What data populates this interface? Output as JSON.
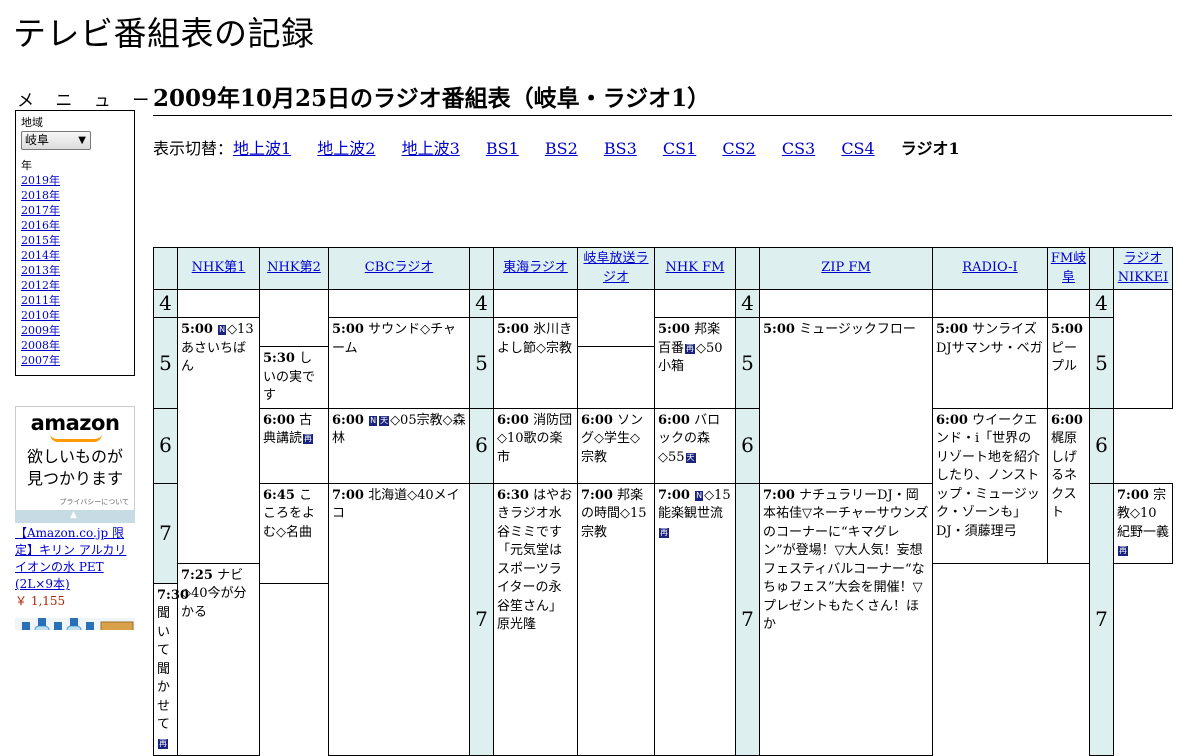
{
  "site": {
    "title": "テレビ番組表の記録"
  },
  "menu": {
    "heading": "メ ニ ュ ー",
    "region_label": "地域",
    "region_value": "岐阜",
    "year_label": "年",
    "years": [
      "2019年",
      "2018年",
      "2017年",
      "2016年",
      "2015年",
      "2014年",
      "2013年",
      "2012年",
      "2011年",
      "2010年",
      "2009年",
      "2008年",
      "2007年"
    ]
  },
  "ad": {
    "logo": "amazon",
    "tagline_1": "欲しいものが",
    "tagline_2": "見つかります",
    "privacy": "プライバシーについて",
    "product": "【Amazon.co.jp 限定】キリン アルカリイオンの水 PET (2L×9本)",
    "price": "￥ 1,155"
  },
  "main": {
    "heading": "2009年10月25日のラジオ番組表（岐阜・ラジオ1）",
    "switch_label": "表示切替：",
    "switch_links": [
      "地上波1",
      "地上波2",
      "地上波3",
      "BS1",
      "BS2",
      "BS3",
      "CS1",
      "CS2",
      "CS3",
      "CS4"
    ],
    "switch_current": "ラジオ1"
  },
  "guide": {
    "stations": [
      "NHK第1",
      "NHK第2",
      "CBCラジオ",
      "東海ラジオ",
      "岐阜放送ラジオ",
      "NHK FM",
      "ZIP FM",
      "RADIO-I",
      "FM岐阜",
      "ラジオNIKKEI"
    ],
    "hours": [
      "4",
      "5",
      "6",
      "7"
    ],
    "icons": {
      "n": "N",
      "ten": "天",
      "saih": "再"
    },
    "programs": {
      "nhk1_0500": {
        "time": "5:00",
        "pre": "",
        "post": "◇13あさいちばん"
      },
      "nhk2_0600": {
        "time": "6:00",
        "pre": "古典講読",
        "post": ""
      },
      "nhk2_0645": {
        "time": "6:45",
        "pre": "こころをよむ◇名曲",
        "post": ""
      },
      "nhk2_0730": {
        "time": "7:30",
        "pre": "聞いて聞かせて",
        "post": ""
      },
      "cbc_0500": {
        "time": "5:00",
        "pre": "サウンド◇チャーム",
        "post": ""
      },
      "cbc_0600": {
        "time": "6:00",
        "pre": "",
        "post": "◇05宗教◇森林"
      },
      "cbc_0700": {
        "time": "7:00",
        "pre": "北海道◇40メイコ",
        "post": ""
      },
      "tokai_0500": {
        "time": "5:00",
        "pre": "氷川きよし節◇宗教",
        "post": ""
      },
      "tokai_0600": {
        "time": "6:00",
        "pre": "消防団◇10歌の楽市",
        "post": ""
      },
      "tokai_0630": {
        "time": "6:30",
        "pre": "はやおきラジオ水谷ミミです「元気堂はスポーツライターの永谷笙さん」原光隆",
        "post": ""
      },
      "gifu_0530": {
        "time": "5:30",
        "pre": "しいの実です",
        "post": ""
      },
      "gifu_0600": {
        "time": "6:00",
        "pre": "ソング◇学生◇宗教",
        "post": ""
      },
      "gifu_0700": {
        "time": "7:00",
        "pre": "邦楽の時間◇15宗教",
        "post": ""
      },
      "nhkfm_0500": {
        "time": "5:00",
        "pre": "邦楽百番",
        "post": "◇50小箱"
      },
      "nhkfm_0600": {
        "time": "6:00",
        "pre": "バロックの森◇55",
        "post": ""
      },
      "nhkfm_0700": {
        "time": "7:00",
        "pre": "",
        "post": "◇15能楽観世流"
      },
      "zip_0500": {
        "time": "5:00",
        "pre": "ミュージックフロー",
        "post": ""
      },
      "zip_0700": {
        "time": "7:00",
        "pre": "ナチュラリーDJ・岡本祐佳▽ネーチャーサウンズのコーナーに“キマグレン”が登場！▽大人気！妄想フェスティバルコーナー“なちゅフェス”大会を開催！▽プレゼントもたくさん！ほか",
        "post": ""
      },
      "radioi_0500": {
        "time": "5:00",
        "pre": "サンライズDJサマンサ・ベガ",
        "post": ""
      },
      "radioi_0600": {
        "time": "6:00",
        "pre": "ウイークエンド・i「世界のリゾート地を紹介したり、ノンストップ・ミュージック・ゾーンも」DJ・須藤理弓",
        "post": ""
      },
      "fmgifu_0500": {
        "time": "5:00",
        "pre": "ピープル",
        "post": ""
      },
      "fmgifu_0600": {
        "time": "6:00",
        "pre": "梶原しげるネクスト",
        "post": ""
      },
      "nikkei_0700": {
        "time": "7:00",
        "pre": "宗教◇10紀野一義",
        "post": ""
      },
      "nikkei_0725": {
        "time": "7:25",
        "pre": "ナビ◇40今が分かる",
        "post": ""
      }
    }
  },
  "colors": {
    "header_bg": "#ddefef",
    "link": "#0000cc",
    "icon_bg": "#1a237e"
  }
}
